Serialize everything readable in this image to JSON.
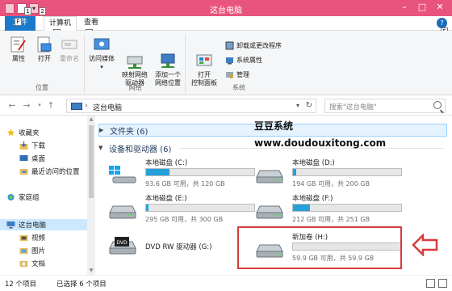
{
  "window": {
    "title": "这台电脑",
    "controls": [
      "–",
      "□",
      "✕"
    ]
  },
  "quick_access": {
    "key1": "1",
    "key2": "2"
  },
  "ribbon_tabs": {
    "file": "文件",
    "file_key": "F",
    "computer": "计算机",
    "computer_key": "C",
    "view": "查看",
    "view_key": "V",
    "help_key": "E"
  },
  "ribbon": {
    "location_group": {
      "label": "位置",
      "properties": "属性",
      "open": "打开",
      "rename": "重命名"
    },
    "network_group": {
      "label": "网络",
      "access_media": "访问媒体",
      "map_drive": "映射网络\n驱动器",
      "add_location": "添加一个\n网络位置"
    },
    "system_group": {
      "label": "系统",
      "open_control_panel": "打开\n控制面板",
      "uninstall": "卸载或更改程序",
      "system_properties": "系统属性",
      "manage": "管理"
    }
  },
  "address_bar": {
    "path": "这台电脑",
    "separator": "›",
    "search_placeholder": "搜索\"这台电脑\""
  },
  "nav_pane": {
    "favorites": "收藏夹",
    "downloads": "下载",
    "desktop": "桌面",
    "recent": "最近访问的位置",
    "homegroup": "家庭组",
    "this_pc": "这台电脑",
    "videos": "视频",
    "pictures": "图片",
    "documents": "文档"
  },
  "content": {
    "folders_header": "文件夹 (6)",
    "devices_header": "设备和驱动器 (6)",
    "drives": [
      {
        "name": "本地磁盘 (C:)",
        "info": "93.6 GB 可用，共 120 GB",
        "used_fraction": 0.22,
        "icon": "windows-drive-icon"
      },
      {
        "name": "本地磁盘 (D:)",
        "info": "194 GB 可用，共 200 GB",
        "used_fraction": 0.03,
        "icon": "hard-drive-icon"
      },
      {
        "name": "本地磁盘 (E:)",
        "info": "295 GB 可用，共 300 GB",
        "used_fraction": 0.02,
        "icon": "hard-drive-icon"
      },
      {
        "name": "本地磁盘 (F:)",
        "info": "212 GB 可用，共 251 GB",
        "used_fraction": 0.16,
        "icon": "hard-drive-icon"
      },
      {
        "name": "DVD RW 驱动器 (G:)",
        "info": "",
        "used_fraction": null,
        "icon": "dvd-drive-icon"
      },
      {
        "name": "新加卷 (H:)",
        "info": "59.9 GB 可用，共 59.9 GB",
        "used_fraction": 0.0,
        "icon": "hard-drive-icon"
      }
    ]
  },
  "watermark": {
    "line1": "豆豆系统",
    "line2": "www.doudouxitong.com"
  },
  "status_bar": {
    "item_count": "12 个项目",
    "selected": "已选择 6 个项目"
  },
  "colors": {
    "titlebar": "#e9547e",
    "accent": "#1979ca",
    "drive_fill": "#26a0da",
    "annotation": "#d73b3b"
  }
}
